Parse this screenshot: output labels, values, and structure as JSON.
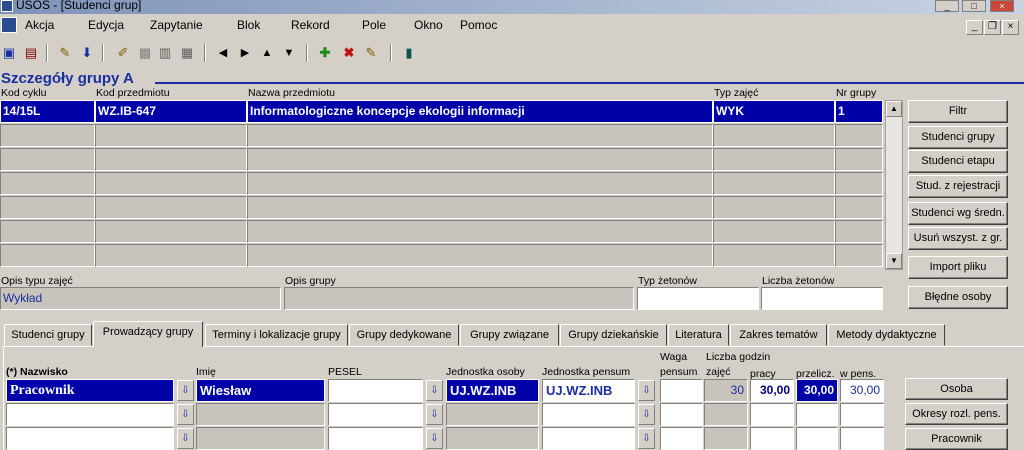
{
  "window": {
    "title": "USOS - [Studenci grup]"
  },
  "menu": [
    "Akcja",
    "Edycja",
    "Zapytanie",
    "Blok",
    "Rekord",
    "Pole",
    "Okno",
    "Pomoc"
  ],
  "section_title": "Szczegóły grupy  A",
  "columns": {
    "kod_cyklu": "Kod cyklu",
    "kod_przedmiotu": "Kod przedmiotu",
    "nazwa_przedmiotu": "Nazwa przedmiotu",
    "typ_zajec": "Typ zajęć",
    "nr_grupy": "Nr grupy"
  },
  "selected_row": {
    "kod_cyklu": "14/15L",
    "kod_przedmiotu": "WZ.IB-647",
    "nazwa_przedmiotu": "Informatologiczne koncepcje ekologii informacji",
    "typ_zajec": "WYK",
    "nr_grupy": "1"
  },
  "side_buttons": [
    "Filtr",
    "Studenci grupy",
    "Studenci etapu",
    "Stud. z rejestracji",
    "Studenci wg średn.",
    "Usuń wszyst. z gr.",
    "Import pliku",
    "Błędne osoby"
  ],
  "details": {
    "opis_typu_label": "Opis typu zajęć",
    "opis_typu_value": "Wykład",
    "opis_grupy_label": "Opis grupy",
    "typ_zetonow_label": "Typ żetonów",
    "liczba_zetonow_label": "Liczba żetonów"
  },
  "tabs": [
    "Studenci grupy",
    "Prowadzący grupy",
    "Terminy i lokalizacje grupy",
    "Grupy dedykowane",
    "Grupy związane",
    "Grupy dziekańskie",
    "Literatura",
    "Zakres tematów",
    "Metody dydaktyczne"
  ],
  "active_tab": "Prowadzący grupy",
  "teachers": {
    "headers": {
      "nazwisko": "(*) Nazwisko",
      "imie": "Imię",
      "pesel": "PESEL",
      "jedn_osoby": "Jednostka osoby",
      "jedn_pensum": "Jednostka pensum",
      "waga_1": "Waga",
      "waga_2": "pensum",
      "liczba_1": "Liczba godzin",
      "liczba_2": "zajęć",
      "pracy": "pracy",
      "przelicz": "przelicz.",
      "w_pens": "w pens."
    },
    "row": {
      "nazwisko": "Pracownik",
      "imie": "Wiesław",
      "pesel": "",
      "jedn_osoby": "UJ.WZ.INB",
      "jedn_pensum": "UJ.WZ.INB",
      "waga": "",
      "zajec": "30",
      "pracy": "30,00",
      "przelicz": "30,00",
      "w_pens": "30,00"
    },
    "buttons": [
      "Osoba",
      "Okresy rozl. pens.",
      "Pracownik"
    ]
  }
}
